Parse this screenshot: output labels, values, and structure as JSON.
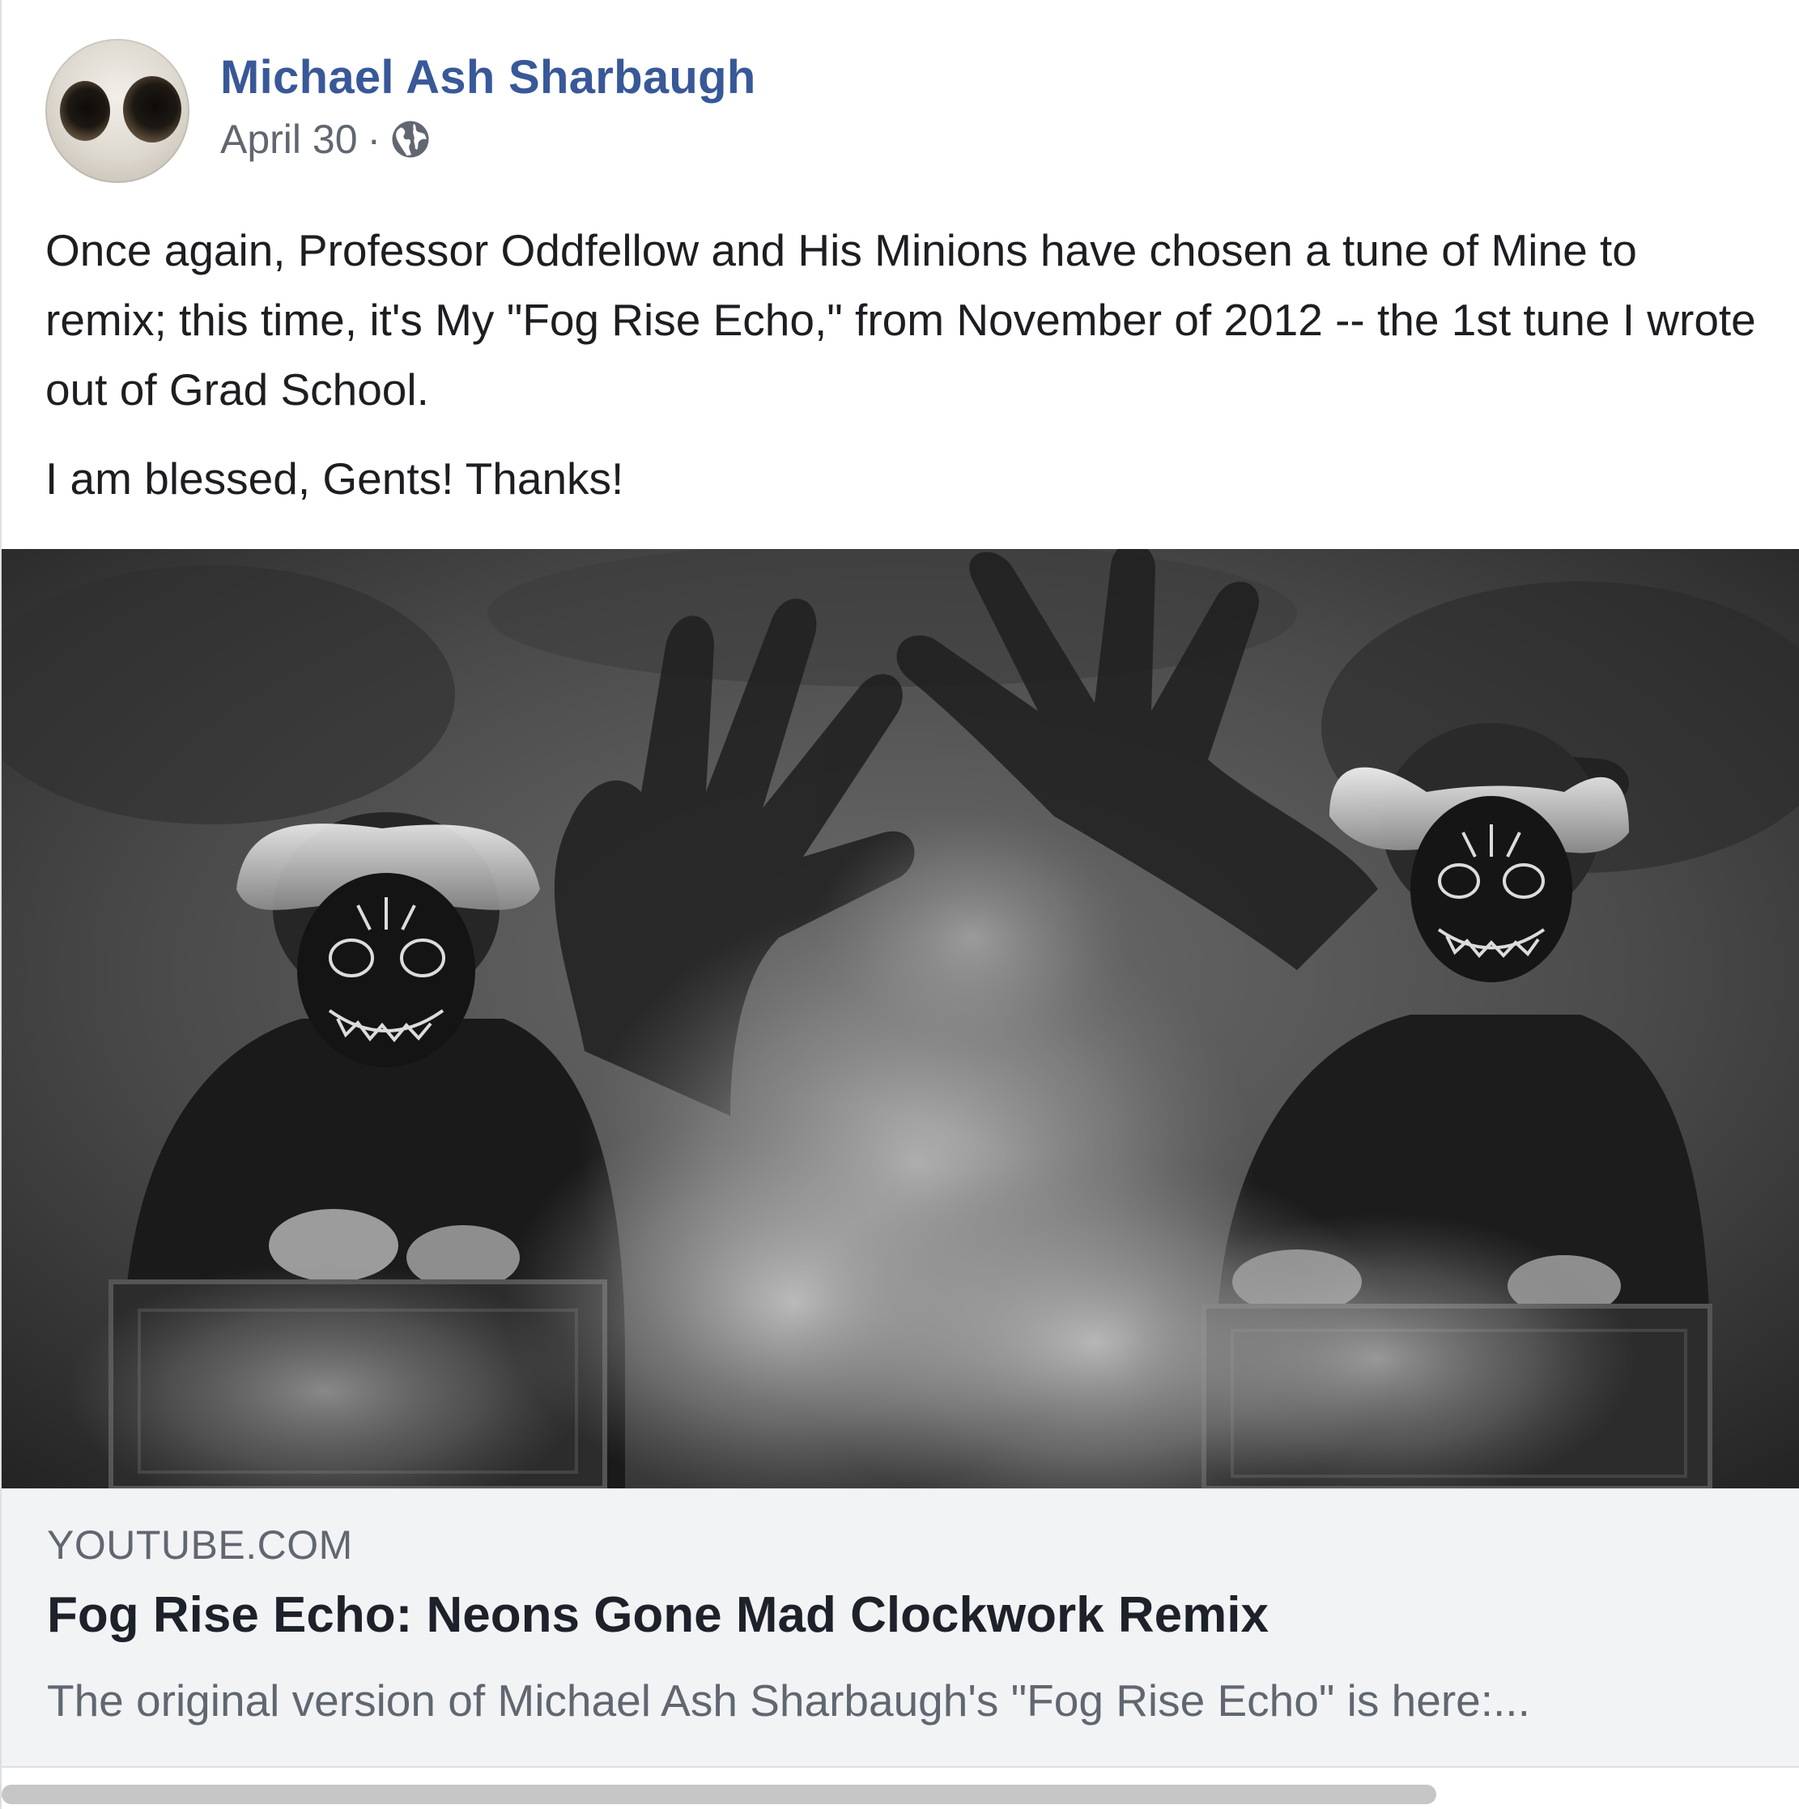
{
  "post": {
    "author": "Michael Ash Sharbaugh",
    "date": "April 30",
    "separator": "·",
    "privacy_icon": "globe-icon",
    "paragraphs": [
      "Once again, Professor Oddfellow and His Minions have chosen a tune of Mine to remix; this time, it's My \"Fog Rise Echo,\" from November of 2012 -- the 1st tune I wrote out of Grad School.",
      "I am blessed, Gents! Thanks!"
    ]
  },
  "link_preview": {
    "domain": "YOUTUBE.COM",
    "title": "Fog Rise Echo: Neons Gone Mad Clockwork Remix",
    "description": "The original version of Michael Ash Sharbaugh's \"Fog Rise Echo\" is here:..."
  },
  "colors": {
    "author_link": "#385898",
    "body_text": "#1c1e21",
    "secondary_text": "#606770",
    "card_background": "#f2f3f5"
  }
}
